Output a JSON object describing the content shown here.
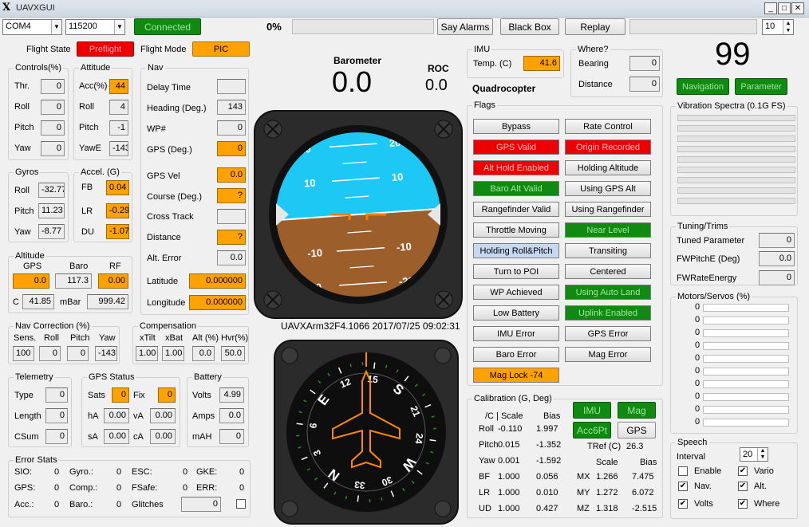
{
  "app": {
    "title": "UAVXGUI"
  },
  "toolbar": {
    "port": "COM4",
    "baud": "115200",
    "connected": "Connected",
    "progress": "0%",
    "say_alarms": "Say Alarms",
    "black_box": "Black Box",
    "replay": "Replay",
    "rate": "10"
  },
  "flight": {
    "state_label": "Flight State",
    "state": "Preflight",
    "mode_label": "Flight Mode",
    "mode": "PIC"
  },
  "controls": {
    "cap": "Controls(%)",
    "thr_l": "Thr.",
    "thr": "0",
    "roll_l": "Roll",
    "roll": "0",
    "pitch_l": "Pitch",
    "pitch": "0",
    "yaw_l": "Yaw",
    "yaw": "0"
  },
  "attitude": {
    "cap": "Attitude",
    "acc_l": "Acc(%)",
    "acc": "44",
    "roll_l": "Roll",
    "roll": "4",
    "pitch_l": "Pitch",
    "pitch": "-1",
    "yawe_l": "YawE",
    "yawe": "-143"
  },
  "nav": {
    "cap": "Nav",
    "delay_l": "Delay Time",
    "delay": "",
    "heading_l": "Heading (Deg.)",
    "heading": "143",
    "wp_l": "WP#",
    "wp": "0",
    "gps_l": "GPS (Deg.)",
    "gps": "0",
    "gpsvel_l": "GPS Vel",
    "gpsvel": "0.0",
    "course_l": "Course (Deg.)",
    "course": "?",
    "cross_l": "Cross Track",
    "cross": "",
    "dist_l": "Distance",
    "dist": "?",
    "alterr_l": "Alt. Error",
    "alterr": "0.0",
    "lat_l": "Latitude",
    "lat": "0.000000",
    "lon_l": "Longitude",
    "lon": "0.000000"
  },
  "gyros": {
    "cap": "Gyros",
    "roll_l": "Roll",
    "roll": "-32.77",
    "pitch_l": "Pitch",
    "pitch": "11.23",
    "yaw_l": "Yaw",
    "yaw": "-8.77"
  },
  "accel": {
    "cap": "Accel. (G)",
    "fb_l": "FB",
    "fb": "0.04",
    "lr_l": "LR",
    "lr": "-0.29",
    "du_l": "DU",
    "du": "-1.07"
  },
  "altitude": {
    "cap": "Altitude",
    "gps_h": "GPS",
    "baro_h": "Baro",
    "rf_h": "RF",
    "gps": "0.0",
    "baro": "117.3",
    "rf": "0.00",
    "c_l": "C",
    "c": "41.85",
    "mbar_l": "mBar",
    "mbar": "999.42"
  },
  "navcorr": {
    "cap": "Nav Correction (%)",
    "sens_h": "Sens.",
    "roll_h": "Roll",
    "pitch_h": "Pitch",
    "yaw_h": "Yaw",
    "sens": "100",
    "roll": "0",
    "pitch": "0",
    "yaw": "-143"
  },
  "comp": {
    "cap": "Compensation",
    "xtilt_h": "xTilt",
    "xbat_h": "xBat",
    "alt_h": "Alt (%)",
    "hvr_h": "Hvr(%)",
    "xtilt": "1.00",
    "xbat": "1.00",
    "alt": "0.0",
    "hvr": "50.0"
  },
  "telemetry": {
    "cap": "Telemetry",
    "type_l": "Type",
    "type": "0",
    "len_l": "Length",
    "len": "0",
    "csum_l": "CSum",
    "csum": "0"
  },
  "gpsstat": {
    "cap": "GPS Status",
    "sats_l": "Sats",
    "sats": "0",
    "fix_l": "Fix",
    "fix": "0",
    "ha_l": "hA",
    "ha": "0.00",
    "va_l": "vA",
    "va": "0.00",
    "sa_l": "sA",
    "sa": "0.00",
    "ca_l": "cA",
    "ca": "0.00"
  },
  "battery": {
    "cap": "Battery",
    "volts_l": "Volts",
    "volts": "4.99",
    "amps_l": "Amps",
    "amps": "0.0",
    "mah_l": "mAH",
    "mah": "0"
  },
  "errors": {
    "cap": "Error Stats",
    "sio_l": "SIO:",
    "sio": "0",
    "gps_l": "GPS:",
    "gps": "0",
    "acc_l": "Acc.:",
    "acc": "0",
    "gyro_l": "Gyro.:",
    "gyro": "0",
    "comp_l": "Comp.:",
    "comp": "0",
    "baro_l": "Baro.:",
    "baro": "0",
    "esc_l": "ESC:",
    "esc": "0",
    "fsafe_l": "FSafe:",
    "fsafe": "0",
    "glitch_l": "Glitches",
    "glitch": "0",
    "gke_l": "GKE:",
    "gke": "0",
    "err_l": "ERR:",
    "err": "0"
  },
  "center": {
    "baro_l": "Barometer",
    "baro": "0.0",
    "roc_l": "ROC",
    "roc": "0.0",
    "airframe": "UAVXArm32F4.1066 2017/07/25 09:02:31"
  },
  "ahi": {
    "pitch_marks": [
      "20",
      "10",
      "-10",
      "-20"
    ]
  },
  "compass": {
    "marks": [
      "15",
      "S",
      "21",
      "24",
      "W",
      "30",
      "33",
      "N",
      "3",
      "6",
      "E",
      "12"
    ]
  },
  "imu": {
    "cap": "IMU",
    "temp_l": "Temp. (C)",
    "temp": "41.6",
    "airframe": "Quadrocopter"
  },
  "where": {
    "cap": "Where?",
    "bearing_l": "Bearing",
    "bearing": "0",
    "distance_l": "Distance",
    "distance": "0"
  },
  "flags": {
    "cap": "Flags",
    "items": [
      {
        "label": "Bypass",
        "state": "off"
      },
      {
        "label": "Rate Control",
        "state": "off"
      },
      {
        "label": "GPS Valid",
        "state": "red"
      },
      {
        "label": "Origin Recorded",
        "state": "red"
      },
      {
        "label": "Alt Hold Enabled",
        "state": "red"
      },
      {
        "label": "Holding Altitude",
        "state": "off"
      },
      {
        "label": "Baro Alt Valid",
        "state": "green"
      },
      {
        "label": "Using GPS Alt",
        "state": "off"
      },
      {
        "label": "Rangefinder Valid",
        "state": "off"
      },
      {
        "label": "Using Rangefinder",
        "state": "off"
      },
      {
        "label": "Throttle Moving",
        "state": "off"
      },
      {
        "label": "Near Level",
        "state": "green"
      },
      {
        "label": "Holding Roll&Pitch",
        "state": "lblue"
      },
      {
        "label": "Transiting",
        "state": "off"
      },
      {
        "label": "Turn to POI",
        "state": "off"
      },
      {
        "label": "Centered",
        "state": "off"
      },
      {
        "label": "WP Achieved",
        "state": "off"
      },
      {
        "label": "Using Auto Land",
        "state": "green"
      },
      {
        "label": "Low Battery",
        "state": "off"
      },
      {
        "label": "Uplink Enabled",
        "state": "green"
      },
      {
        "label": "IMU Error",
        "state": "off"
      },
      {
        "label": "GPS Error",
        "state": "off"
      },
      {
        "label": "Baro Error",
        "state": "off"
      },
      {
        "label": "Mag Error",
        "state": "off"
      },
      {
        "label": "Mag Lock -74",
        "state": "orange"
      }
    ]
  },
  "calib": {
    "cap": "Calibration (G, Deg)",
    "head1": "/C | Scale",
    "head2": "Bias",
    "rows": [
      {
        "l": "Roll",
        "s": "-0.110",
        "b": "1.997"
      },
      {
        "l": "Pitch",
        "s": "0.015",
        "b": "-1.352"
      },
      {
        "l": "Yaw",
        "s": "0.001",
        "b": "-1.592"
      },
      {
        "l": "BF",
        "s": "1.000",
        "b": "0.056"
      },
      {
        "l": "LR",
        "s": "1.000",
        "b": "0.010"
      },
      {
        "l": "UD",
        "s": "1.000",
        "b": "0.427"
      }
    ],
    "imu_btn": "IMU",
    "mag_btn": "Mag",
    "acc6_btn": "Acc6Pt",
    "gps_btn": "GPS",
    "tref_l": "TRef (C)",
    "tref": "26.3",
    "scale_h": "Scale",
    "bias_h": "Bias",
    "mrows": [
      {
        "l": "MX",
        "s": "1.266",
        "b": "7.475"
      },
      {
        "l": "MY",
        "s": "1.272",
        "b": "6.072"
      },
      {
        "l": "MZ",
        "s": "1.318",
        "b": "-2.515"
      }
    ]
  },
  "right": {
    "big": "99",
    "nav_btn": "Navigation",
    "param_btn": "Parameter",
    "vib_cap": "Vibration Spectra (0.1G FS)",
    "tuning_cap": "Tuning/Trims",
    "tuned_l": "Tuned Parameter",
    "tuned": "0",
    "fwp_l": "FWPitchE (Deg)",
    "fwp": "0.0",
    "fwr_l": "FWRateEnergy",
    "fwr": "0",
    "motors_cap": "Motors/Servos (%)",
    "motors": [
      "0",
      "0",
      "0",
      "0",
      "0",
      "0",
      "0",
      "0",
      "0",
      "0"
    ],
    "speech_cap": "Speech",
    "interval_l": "Interval",
    "interval": "20",
    "enable_l": "Enable",
    "vario_l": "Vario",
    "nav_l": "Nav.",
    "alt_l": "Alt.",
    "volts_l": "Volts",
    "where_l": "Where"
  },
  "colors": {
    "sky": "#1ec8f5",
    "ground": "#9c5f2c",
    "orange": "#ffa200",
    "green": "#108a10",
    "red": "#ee0000"
  }
}
